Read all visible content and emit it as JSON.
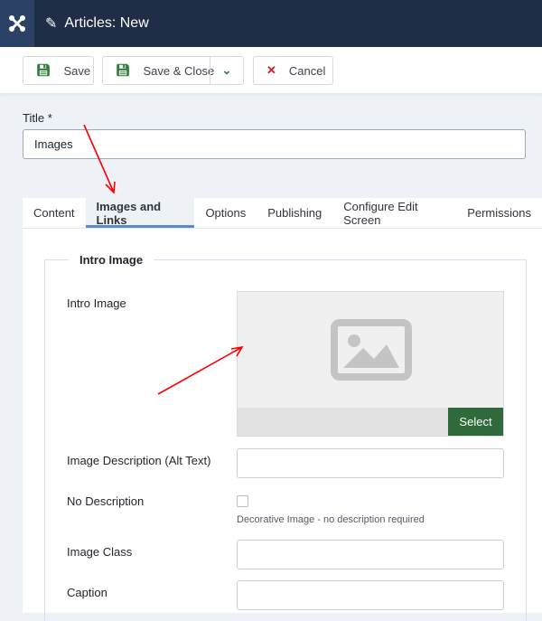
{
  "header": {
    "title": "Articles: New",
    "logo_icon": "joomla-logo-icon",
    "title_icon": "pencil-icon"
  },
  "toolbar": {
    "save": "Save",
    "save_close": "Save & Close",
    "cancel": "Cancel"
  },
  "form": {
    "title_label": "Title *",
    "title_value": "Images"
  },
  "tabs": [
    {
      "label": "Content"
    },
    {
      "label": "Images and Links",
      "active": true
    },
    {
      "label": "Options"
    },
    {
      "label": "Publishing"
    },
    {
      "label": "Configure Edit Screen"
    },
    {
      "label": "Permissions"
    }
  ],
  "intro": {
    "legend": "Intro Image",
    "image_label": "Intro Image",
    "select": "Select",
    "alt_label": "Image Description (Alt Text)",
    "nodesc_label": "No Description",
    "nodesc_help": "Decorative Image - no description required",
    "class_label": "Image Class",
    "caption_label": "Caption"
  },
  "colors": {
    "header": "#1f2d46",
    "select_button": "#2f6b3a",
    "annotation_arrow": "#ff0000"
  }
}
